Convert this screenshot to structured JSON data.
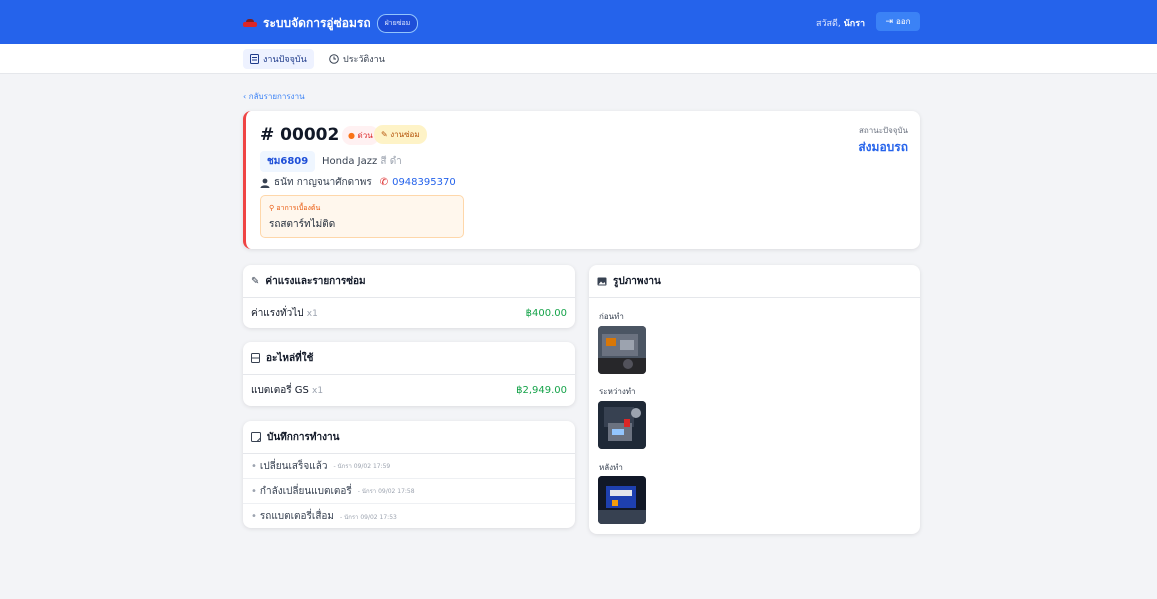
{
  "header": {
    "app_title": "ระบบจัดการอู่ซ่อมรถ",
    "role_badge": "ฝ่ายซ่อม",
    "greeting": "สวัสดี,",
    "user_name": "นักรา",
    "logout_label": "ออก",
    "brand_color": "#2563eb"
  },
  "nav": {
    "tabs": [
      {
        "label": "งานปัจจุบัน",
        "icon": "document-icon",
        "active": true
      },
      {
        "label": "ประวัติงาน",
        "icon": "clock-icon",
        "active": false
      }
    ]
  },
  "back_link": "‹ กลับรายการงาน",
  "job": {
    "number": "# 00002",
    "urgent_label": "ด่วน",
    "type_label": "งานซ่อม",
    "plate": "ชม6809",
    "model": "Honda Jazz",
    "color": "สี ดำ",
    "owner": "ธนัท กาญจนาศักดาพร",
    "phone": "0948395370",
    "symptom_label": "อาการเบื้องต้น",
    "symptom": "รถสตาร์ทไม่ติด",
    "status_label": "สถานะปัจจุบัน",
    "status": "ส่งมอบรถ"
  },
  "labor": {
    "title": "ค่าแรงและรายการซ่อม",
    "items": [
      {
        "name": "ค่าแรงทั่วไป",
        "qty": "x1",
        "price": "฿400.00"
      }
    ]
  },
  "parts": {
    "title": "อะไหล่ที่ใช้",
    "items": [
      {
        "name": "แบตเตอรี่ GS",
        "qty": "x1",
        "price": "฿2,949.00"
      }
    ]
  },
  "logs": {
    "title": "บันทึกการทำงาน",
    "items": [
      {
        "text": "เปลี่ยนเสร็จแล้ว",
        "meta": "- นักรา 09/02 17:59"
      },
      {
        "text": "กำลังเปลี่ยนแบตเตอรี่",
        "meta": "- นักรา 09/02 17:58"
      },
      {
        "text": "รถแบตเตอรี่เสื่อม",
        "meta": "- นักรา 09/02 17:53"
      }
    ]
  },
  "photos": {
    "title": "รูปภาพงาน",
    "groups": [
      {
        "label": "ก่อนทำ"
      },
      {
        "label": "ระหว่างทำ"
      },
      {
        "label": "หลังทำ"
      }
    ]
  }
}
